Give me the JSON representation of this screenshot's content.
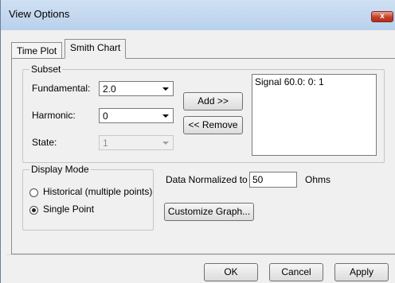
{
  "window": {
    "title": "View Options",
    "close_label": "x"
  },
  "tabs": [
    {
      "label": "Time Plot",
      "active": false
    },
    {
      "label": "Smith Chart",
      "active": true
    }
  ],
  "subset": {
    "legend": "Subset",
    "fundamental_label": "Fundamental:",
    "fundamental_value": "2.0",
    "harmonic_label": "Harmonic:",
    "harmonic_value": "0",
    "state_label": "State:",
    "state_value": "1",
    "add_button": "Add >>",
    "remove_button": "<< Remove",
    "list_items": [
      "Signal 60.0: 0: 1"
    ]
  },
  "display_mode": {
    "legend": "Display Mode",
    "options": [
      {
        "label": "Historical (multiple points)",
        "selected": false
      },
      {
        "label": "Single Point",
        "selected": true
      }
    ]
  },
  "normalization": {
    "label": "Data Normalized to",
    "value": "50",
    "unit": "Ohms"
  },
  "customize_button": "Customize Graph...",
  "footer": {
    "ok": "OK",
    "cancel": "Cancel",
    "apply": "Apply"
  }
}
